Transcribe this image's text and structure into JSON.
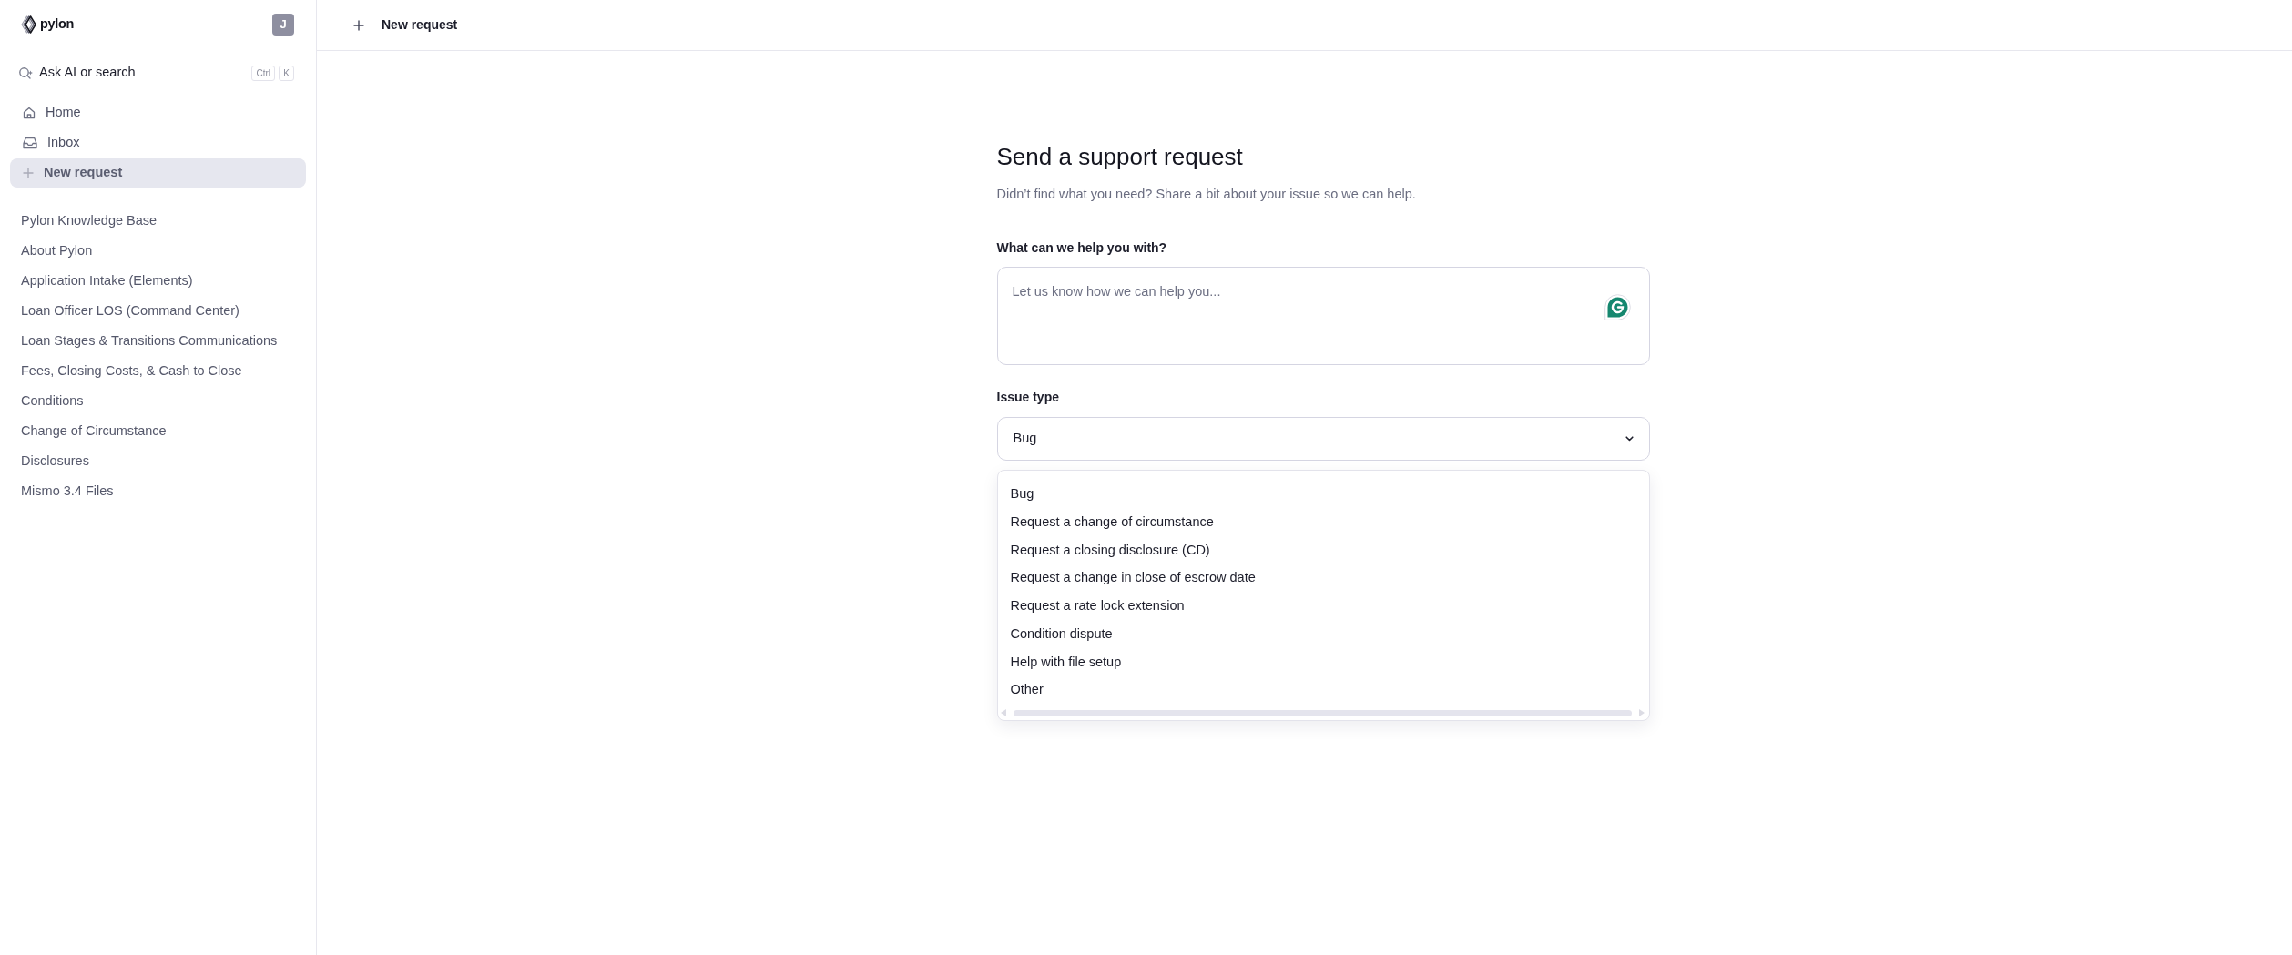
{
  "sidebar": {
    "logo": {
      "text": "pylon"
    },
    "avatar": {
      "initial": "J"
    },
    "search": {
      "label": "Ask AI or search",
      "shortcut": [
        "Ctrl",
        "K"
      ]
    },
    "nav": [
      {
        "label": "Home",
        "selected": false
      },
      {
        "label": "Inbox",
        "selected": false
      },
      {
        "label": "New request",
        "selected": true
      }
    ],
    "knowledge_base": [
      "Pylon Knowledge Base",
      "About Pylon",
      "Application Intake (Elements)",
      "Loan Officer LOS (Command Center)",
      "Loan Stages & Transitions Communications",
      "Fees, Closing Costs, & Cash to Close",
      "Conditions",
      "Change of Circumstance",
      "Disclosures",
      "Mismo 3.4 Files"
    ]
  },
  "header": {
    "title": "New request"
  },
  "form": {
    "title": "Send a support request",
    "subtitle": "Didn’t find what you need? Share a bit about your issue so we can help.",
    "fields": [
      {
        "kind": "textarea",
        "label": "What can we help you with?",
        "placeholder": "Let us know how we can help you..."
      },
      {
        "kind": "select",
        "label": "Issue type",
        "value": "Bug",
        "expanded": true,
        "options": [
          "Bug",
          "Request a change of circumstance",
          "Request a closing disclosure (CD)",
          "Request a change in close of escrow date",
          "Request a rate lock extension",
          "Condition dispute",
          "Help with file setup",
          "Other"
        ]
      }
    ]
  }
}
